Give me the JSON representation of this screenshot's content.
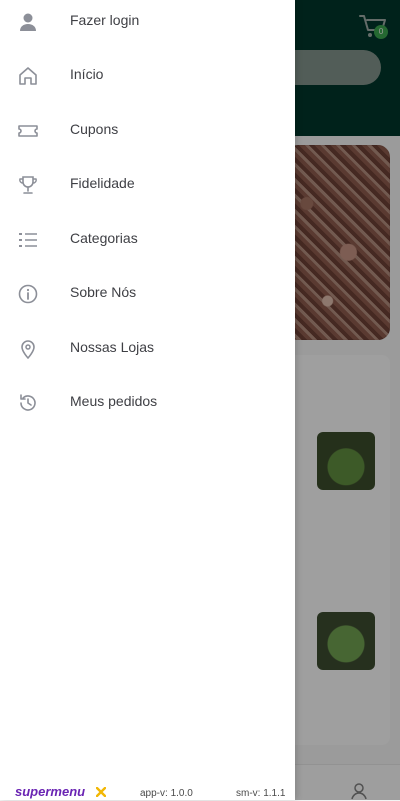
{
  "background": {
    "cart_badge_count": "0"
  },
  "drawer": {
    "items": [
      {
        "label": "Fazer login",
        "icon": "user-icon"
      },
      {
        "label": "Início",
        "icon": "home-icon"
      },
      {
        "label": "Cupons",
        "icon": "ticket-icon"
      },
      {
        "label": "Fidelidade",
        "icon": "trophy-icon"
      },
      {
        "label": "Categorias",
        "icon": "list-icon"
      },
      {
        "label": "Sobre Nós",
        "icon": "info-icon"
      },
      {
        "label": "Nossas Lojas",
        "icon": "location-pin-icon"
      },
      {
        "label": "Meus pedidos",
        "icon": "history-icon"
      }
    ],
    "footer": {
      "brand": "supermenu",
      "app_version": "app-v: 1.0.0",
      "sm_version": "sm-v: 1.1.1"
    }
  },
  "colors": {
    "header_bg": "#00352a",
    "badge": "#3aa24d",
    "brand_purple": "#6a24b3",
    "icon_gray": "#8c8f98"
  }
}
